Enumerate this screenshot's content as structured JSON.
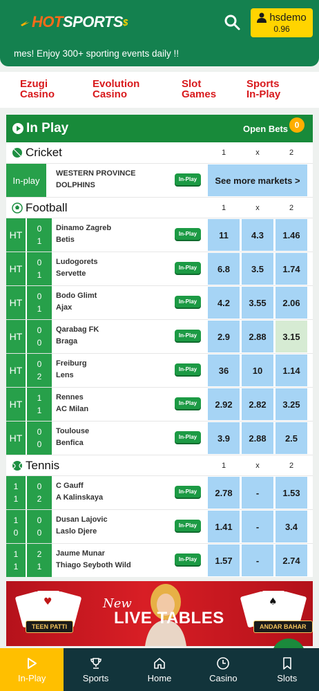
{
  "header": {
    "logo_hot": "HOT",
    "logo_sports": "SPORTS",
    "username": "hsdemo",
    "balance": "0.96"
  },
  "ticker": {
    "text": "mes! Enjoy 300+ sporting events daily !!"
  },
  "game_nav": [
    {
      "line1": "Ezugi",
      "line2": "Casino"
    },
    {
      "line1": "Evolution",
      "line2": "Casino"
    },
    {
      "line1": "Slot",
      "line2": "Games"
    },
    {
      "line1": "Sports",
      "line2": "In-Play"
    }
  ],
  "inplay": {
    "title": "In Play",
    "open_bets_label": "Open Bets",
    "open_bets_count": "0"
  },
  "columns": {
    "c1": "1",
    "cx": "x",
    "c2": "2"
  },
  "inplay_tag": "In-Play",
  "cricket": {
    "title": "Cricket",
    "status": "In-play",
    "team1": "WESTERN PROVINCE",
    "team2": "DOLPHINS",
    "see_more": "See more markets >"
  },
  "football": {
    "title": "Football",
    "matches": [
      {
        "status": "HT",
        "s1": "0",
        "s2": "1",
        "team1": "Dinamo Zagreb",
        "team2": "Betis",
        "o1": "11",
        "ox": "4.3",
        "o2": "1.46"
      },
      {
        "status": "HT",
        "s1": "0",
        "s2": "1",
        "team1": "Ludogorets",
        "team2": "Servette",
        "o1": "6.8",
        "ox": "3.5",
        "o2": "1.74"
      },
      {
        "status": "HT",
        "s1": "0",
        "s2": "1",
        "team1": "Bodo Glimt",
        "team2": "Ajax",
        "o1": "4.2",
        "ox": "3.55",
        "o2": "2.06"
      },
      {
        "status": "HT",
        "s1": "0",
        "s2": "0",
        "team1": "Qarabag FK",
        "team2": "Braga",
        "o1": "2.9",
        "ox": "2.88",
        "o2": "3.15"
      },
      {
        "status": "HT",
        "s1": "0",
        "s2": "2",
        "team1": "Freiburg",
        "team2": "Lens",
        "o1": "36",
        "ox": "10",
        "o2": "1.14"
      },
      {
        "status": "HT",
        "s1": "1",
        "s2": "1",
        "team1": "Rennes",
        "team2": "AC Milan",
        "o1": "2.92",
        "ox": "2.82",
        "o2": "3.25"
      },
      {
        "status": "HT",
        "s1": "0",
        "s2": "0",
        "team1": "Toulouse",
        "team2": "Benfica",
        "o1": "3.9",
        "ox": "2.88",
        "o2": "2.5"
      }
    ]
  },
  "tennis": {
    "title": "Tennis",
    "matches": [
      {
        "set1": "1",
        "set2": "1",
        "g1": "0",
        "g2": "2",
        "team1": "C Gauff",
        "team2": "A Kalinskaya",
        "o1": "2.78",
        "ox": "-",
        "o2": "1.53"
      },
      {
        "set1": "1",
        "set2": "0",
        "g1": "0",
        "g2": "0",
        "team1": "Dusan Lajovic",
        "team2": "Laslo Djere",
        "o1": "1.41",
        "ox": "-",
        "o2": "3.4"
      },
      {
        "set1": "1",
        "set2": "1",
        "g1": "2",
        "g2": "1",
        "team1": "Jaume Munar",
        "team2": "Thiago Seyboth Wild",
        "o1": "1.57",
        "ox": "-",
        "o2": "2.74"
      }
    ]
  },
  "banner": {
    "new": "New",
    "title": "LIVE TABLES",
    "left_tag": "TEEN PATTI",
    "right_tag": "ANDAR BAHAR"
  },
  "bottom_nav": [
    {
      "label": "In-Play",
      "icon": "play-icon"
    },
    {
      "label": "Sports",
      "icon": "trophy-icon"
    },
    {
      "label": "Home",
      "icon": "home-icon"
    },
    {
      "label": "Casino",
      "icon": "clock-icon"
    },
    {
      "label": "Slots",
      "icon": "bookmark-icon"
    }
  ],
  "colors": {
    "brand_green": "#14814f",
    "accent_yellow": "#ffd400",
    "odds_blue": "#a6d4f5",
    "link_red": "#d8191c"
  }
}
